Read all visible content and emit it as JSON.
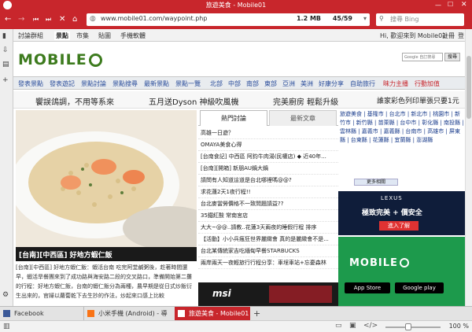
{
  "window": {
    "title": "旅遊美食 - Mobile01"
  },
  "toolbar": {
    "url": "www.mobile01.com/waypoint.php",
    "page_size": "1.2 MB",
    "progress": "45/59",
    "search_placeholder": "搜尋 Bing"
  },
  "site": {
    "top_tabs": [
      "討論群組",
      "景點",
      "市集",
      "貼圖",
      "手機軟體"
    ],
    "user_greeting": "Hi, 歡迎來到 Mobile01",
    "top_right_links": [
      "註冊",
      "登"
    ],
    "logo_text": "MOBILE",
    "google_search_label": "Google 自訂搜尋",
    "google_search_button": "搜尋",
    "categories": [
      "發表景點",
      "發表遊記",
      "景點討論",
      "景點搜尋",
      "最新景點",
      "景點一覽",
      "北部",
      "中部",
      "南部",
      "東部",
      "亞洲",
      "美洲",
      "好康分享",
      "自助旅行",
      "昧力主播",
      "行動加值"
    ],
    "promos": [
      "饗誤鴿調，不用等系來",
      "五月送Dyson 神級吹風機",
      "完美廚房 輕鬆升級",
      "誰家彩色列印單張只要1元"
    ],
    "hero_caption": "[台南][中西區] 好地方蝦仁飯",
    "hero_text": "[台南][中西區] 好地方蝦仁飯：蝦活台南 吃完阿堂鹹粥後，趁著時間還早，蝦活旱餐團來到了成功路與海安路二段的交叉路口，準備開始第二攤的行程：好地方蝦仁飯，台南的蝦仁飯分為兩種，農早期是從日式炒飯衍生出來的，官婦以蘿蔔乾下去生抄的作法，炒起來口感上比較",
    "news_tabs": [
      "熱門討論",
      "最新文章"
    ],
    "news_items": [
      "高雄一日遊？",
      "OMAYA美食心得",
      "[台南食記] 中西區 阿鈞牛肉湯(民權店) ◆ 近40年...",
      "[台南][開箱] 新朋AU鍋大鍋",
      "請問有人知道這道是台北哪裡嗎@@?",
      "求花蓮2天1夜行程!!",
      "台北麥當勞價格不一致問題請益??",
      "35鐵紅酸 常南宮店",
      "大大~@@..請教..花蓮3天兩夜的睡假行程 排序",
      "【活動】小小兵瘋狂世界麗緻會 真的是麗緻會不是...",
      "台北某傳統家吉吃緬甸早餐STARBUCKS",
      "兩岸兩天一夜輕旅行行程分享：車埕車站+忘憂森林"
    ],
    "news_more": "more",
    "right_categories": "旅遊美食 | 基隆市 | 台北市 | 新北市 | 桃園市 | 新竹市 | 新竹縣 | 苗栗縣 | 台中市 | 彰化縣 | 南投縣 | 雲林縣 | 嘉義市 | 嘉義縣 | 台南市 | 高雄市 | 屏東縣 | 台東縣 | 花蓮縣 | 宜蘭縣 | 澎湖縣",
    "hot_button": "更多相關",
    "ad_lexus_brand": "LEXUS",
    "ad_lexus_line1": "極致完美 + 價安全",
    "ad_lexus_line2": "進入了解",
    "ad_mobile_logo": "MOBILE",
    "ad_appstore": "App Store",
    "ad_googleplay": "Google play",
    "ad_msi": "msi"
  },
  "tabs": [
    {
      "label": "Facebook",
      "color": "#3b5998"
    },
    {
      "label": "小米手機 (Android) - 導",
      "color": "#f97316"
    },
    {
      "label": "旅遊美食 - Mobile01",
      "color": "#c8262c"
    }
  ],
  "status": {
    "zoom": "100 %"
  },
  "colors": {
    "accent": "#c8262c",
    "logo_green": "#3d7b1e",
    "link": "#2a4d9b"
  }
}
